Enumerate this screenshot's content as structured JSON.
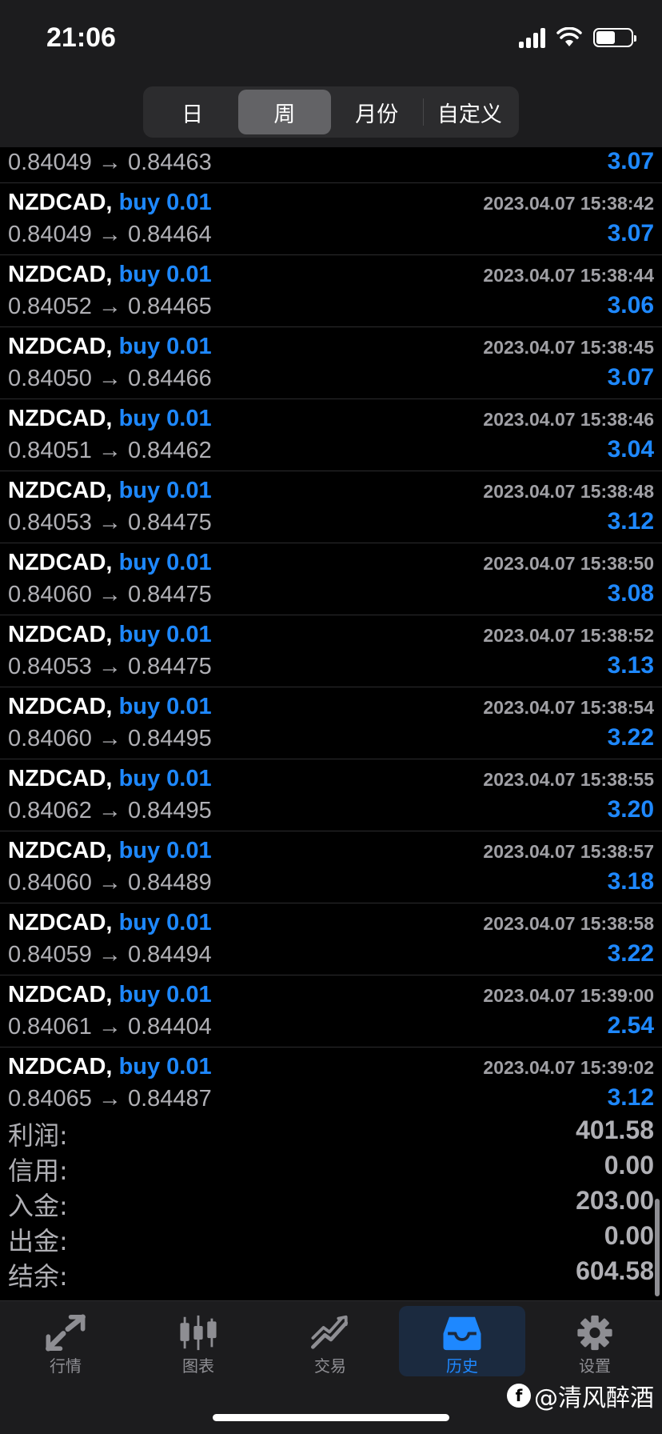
{
  "status_bar": {
    "time": "21:06"
  },
  "period_tabs": [
    {
      "label": "日",
      "active": false
    },
    {
      "label": "周",
      "active": true
    },
    {
      "label": "月份",
      "active": false
    },
    {
      "label": "自定义",
      "active": false
    }
  ],
  "partial_row": {
    "prices": "0.84049 → 0.84463",
    "profit": "3.07"
  },
  "trades": [
    {
      "symbol": "NZDCAD,",
      "side": "buy 0.01",
      "time": "2023.04.07 15:38:42",
      "prices": "0.84049 → 0.84464",
      "profit": "3.07"
    },
    {
      "symbol": "NZDCAD,",
      "side": "buy 0.01",
      "time": "2023.04.07 15:38:44",
      "prices": "0.84052 → 0.84465",
      "profit": "3.06"
    },
    {
      "symbol": "NZDCAD,",
      "side": "buy 0.01",
      "time": "2023.04.07 15:38:45",
      "prices": "0.84050 → 0.84466",
      "profit": "3.07"
    },
    {
      "symbol": "NZDCAD,",
      "side": "buy 0.01",
      "time": "2023.04.07 15:38:46",
      "prices": "0.84051 → 0.84462",
      "profit": "3.04"
    },
    {
      "symbol": "NZDCAD,",
      "side": "buy 0.01",
      "time": "2023.04.07 15:38:48",
      "prices": "0.84053 → 0.84475",
      "profit": "3.12"
    },
    {
      "symbol": "NZDCAD,",
      "side": "buy 0.01",
      "time": "2023.04.07 15:38:50",
      "prices": "0.84060 → 0.84475",
      "profit": "3.08"
    },
    {
      "symbol": "NZDCAD,",
      "side": "buy 0.01",
      "time": "2023.04.07 15:38:52",
      "prices": "0.84053 → 0.84475",
      "profit": "3.13"
    },
    {
      "symbol": "NZDCAD,",
      "side": "buy 0.01",
      "time": "2023.04.07 15:38:54",
      "prices": "0.84060 → 0.84495",
      "profit": "3.22"
    },
    {
      "symbol": "NZDCAD,",
      "side": "buy 0.01",
      "time": "2023.04.07 15:38:55",
      "prices": "0.84062 → 0.84495",
      "profit": "3.20"
    },
    {
      "symbol": "NZDCAD,",
      "side": "buy 0.01",
      "time": "2023.04.07 15:38:57",
      "prices": "0.84060 → 0.84489",
      "profit": "3.18"
    },
    {
      "symbol": "NZDCAD,",
      "side": "buy 0.01",
      "time": "2023.04.07 15:38:58",
      "prices": "0.84059 → 0.84494",
      "profit": "3.22"
    },
    {
      "symbol": "NZDCAD,",
      "side": "buy 0.01",
      "time": "2023.04.07 15:39:00",
      "prices": "0.84061 → 0.84404",
      "profit": "2.54"
    },
    {
      "symbol": "NZDCAD,",
      "side": "buy 0.01",
      "time": "2023.04.07 15:39:02",
      "prices": "0.84065 → 0.84487",
      "profit": "3.12"
    }
  ],
  "summary": [
    {
      "label": "利润:",
      "value": "401.58"
    },
    {
      "label": "信用:",
      "value": "0.00"
    },
    {
      "label": "入金:",
      "value": "203.00"
    },
    {
      "label": "出金:",
      "value": "0.00"
    },
    {
      "label": "结余:",
      "value": "604.58"
    }
  ],
  "tab_bar": [
    {
      "label": "行情",
      "icon": "quotes-arrows-icon",
      "active": false
    },
    {
      "label": "图表",
      "icon": "candlestick-chart-icon",
      "active": false
    },
    {
      "label": "交易",
      "icon": "trade-trend-icon",
      "active": false
    },
    {
      "label": "历史",
      "icon": "history-inbox-icon",
      "active": true
    },
    {
      "label": "设置",
      "icon": "gear-icon",
      "active": false
    }
  ],
  "watermark": {
    "text": "@清风醉酒"
  },
  "colors": {
    "accent": "#1e88ff",
    "background": "#000000",
    "bar": "#1c1c1e"
  }
}
